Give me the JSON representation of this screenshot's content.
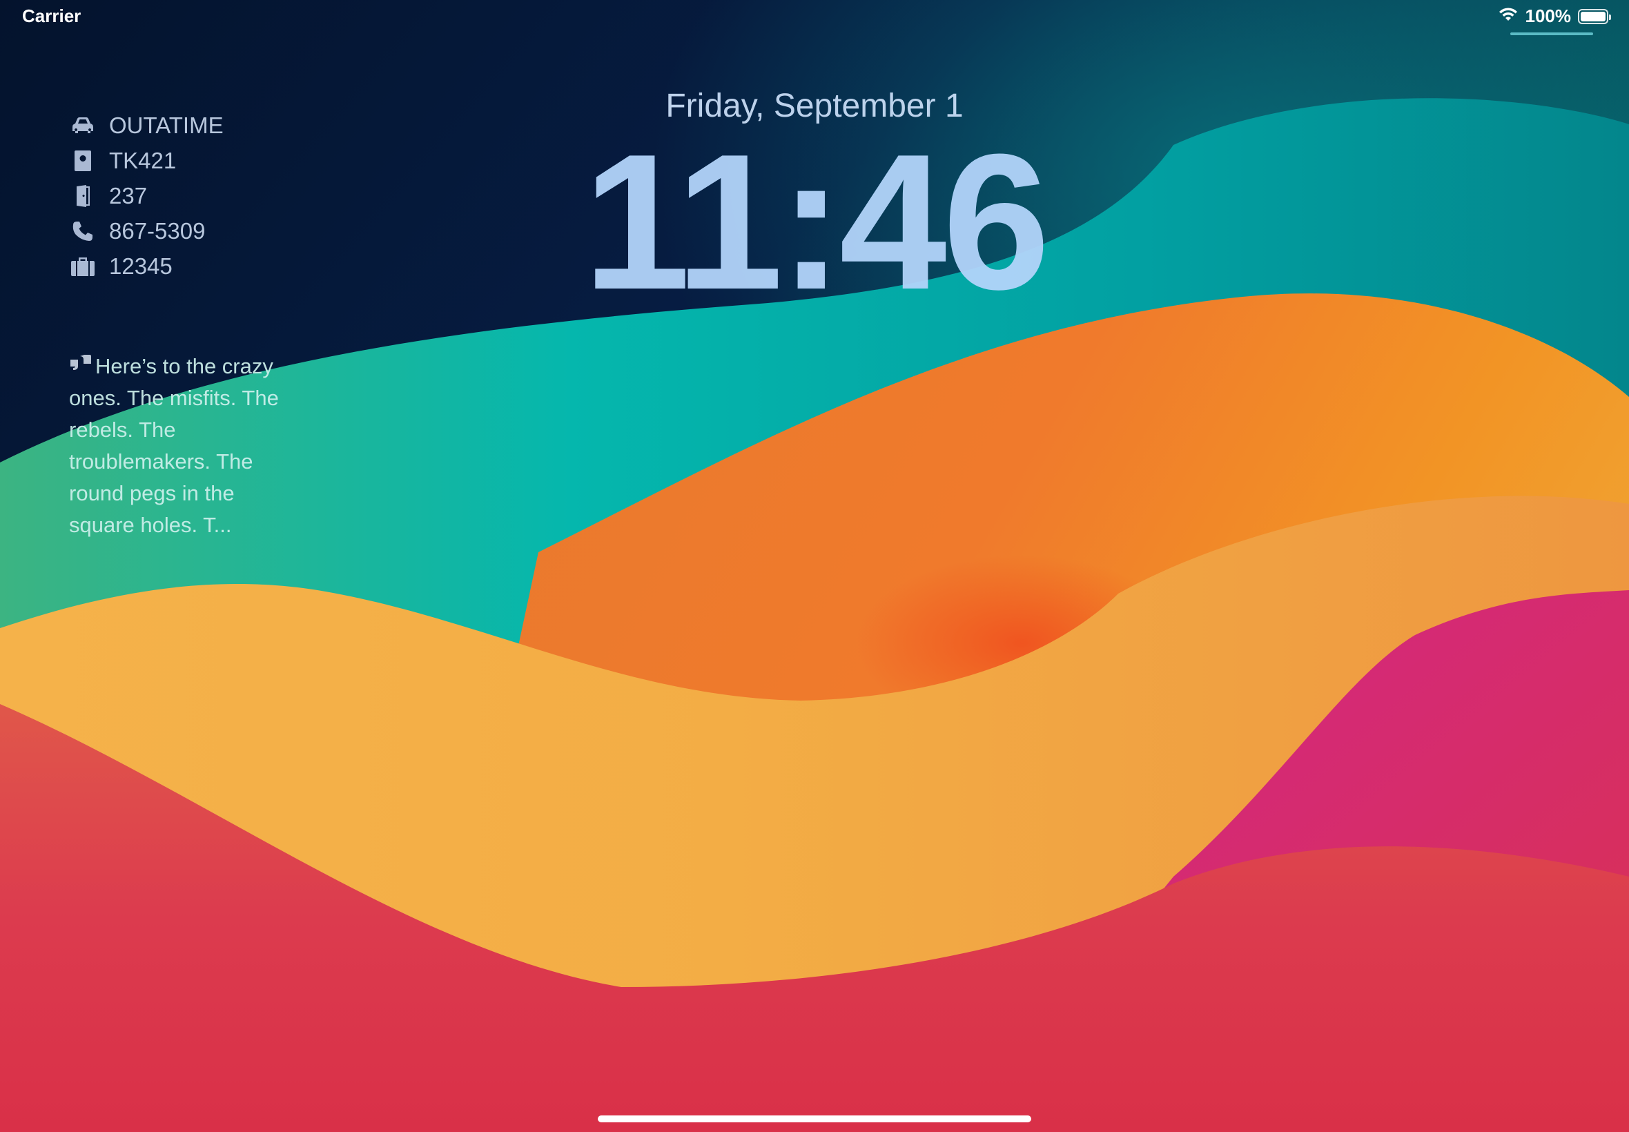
{
  "status_bar": {
    "carrier": "Carrier",
    "battery_percent": "100%",
    "wifi_icon": "wifi-icon",
    "battery_icon": "battery-full-icon"
  },
  "lock_screen": {
    "date": "Friday, September 1",
    "time": "11:46"
  },
  "info_widget": {
    "items": [
      {
        "icon": "car-icon",
        "value": "OUTATIME"
      },
      {
        "icon": "id-badge-icon",
        "value": "TK421"
      },
      {
        "icon": "door-icon",
        "value": "237"
      },
      {
        "icon": "phone-icon",
        "value": "867-5309"
      },
      {
        "icon": "suitcase-icon",
        "value": "12345"
      }
    ]
  },
  "quote_widget": {
    "icon": "quote-icon",
    "text": "Here’s to the crazy ones. The misfits. The rebels. The troublemakers. The round pegs in the square holes. T..."
  },
  "colors": {
    "navy": "#071a3d",
    "teal": "#03a8a6",
    "orange": "#f08a2c",
    "magenta": "#d42a7e",
    "red": "#dc3a4e"
  }
}
